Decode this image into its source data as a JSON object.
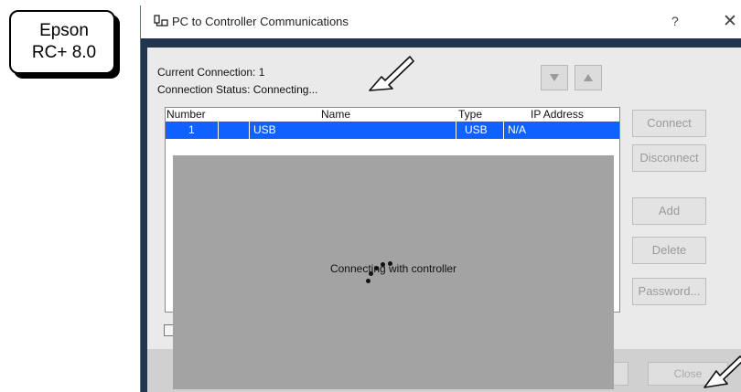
{
  "callout": {
    "line1": "Epson",
    "line2": "RC+ 8.0"
  },
  "window": {
    "title": "PC to Controller Communications",
    "help_label": "?",
    "close_label": "✕"
  },
  "status": {
    "current_connection": "Current Connection: 1",
    "connection_status": "Connection Status: Connecting..."
  },
  "buttons": {
    "move_down": "▼",
    "move_up": "▲",
    "connect": "Connect",
    "disconnect": "Disconnect",
    "add": "Add",
    "delete": "Delete",
    "password": "Password...",
    "ok": "",
    "apply": "",
    "close": "Close"
  },
  "table": {
    "columns": [
      "Number",
      "Name",
      "Type",
      "IP Address"
    ],
    "rows": [
      {
        "number": "1",
        "name": "USB",
        "type": "USB",
        "ip": "N/A"
      }
    ]
  },
  "overlay": {
    "message": "Connecting with controller"
  },
  "colors": {
    "selection": "#0f62ff",
    "window_frame": "#23344f",
    "overlay": "#a3a3a3"
  }
}
